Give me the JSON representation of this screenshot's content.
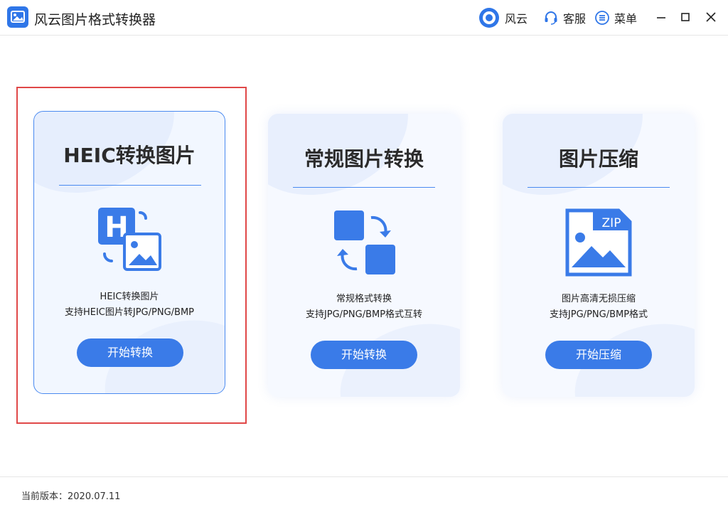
{
  "app": {
    "title": "风云图片格式转换器"
  },
  "titlebar": {
    "brand_label": "风云",
    "service_label": "客服",
    "menu_label": "菜单"
  },
  "cards": [
    {
      "title": "HEIC转换图片",
      "desc_line1": "HEIC转换图片",
      "desc_line2": "支持HEIC图片转JPG/PNG/BMP",
      "button": "开始转换",
      "icon": "heic-convert-icon"
    },
    {
      "title": "常规图片转换",
      "desc_line1": "常规格式转换",
      "desc_line2": "支持JPG/PNG/BMP格式互转",
      "button": "开始转换",
      "icon": "format-swap-icon"
    },
    {
      "title": "图片压缩",
      "desc_line1": "图片高清无损压缩",
      "desc_line2": "支持JPG/PNG/BMP格式",
      "button": "开始压缩",
      "icon": "zip-image-icon",
      "icon_badge": "ZIP"
    }
  ],
  "footer": {
    "version": "当前版本：2020.07.11"
  },
  "colors": {
    "accent": "#3a7be8",
    "highlight": "#e04848"
  }
}
